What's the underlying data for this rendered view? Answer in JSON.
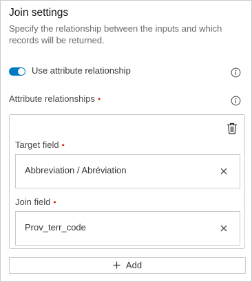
{
  "section": {
    "title": "Join settings",
    "description": "Specify the relationship between the inputs and which records will be returned."
  },
  "toggle": {
    "label": "Use attribute relationship",
    "checked": true,
    "color": "#007ac2"
  },
  "attribute_relationships": {
    "label": "Attribute relationships",
    "required_marker": "•",
    "target_field": {
      "label": "Target field",
      "required_marker": "•",
      "value": "Abbreviation / Abréviation"
    },
    "join_field": {
      "label": "Join field",
      "required_marker": "•",
      "value": "Prov_terr_code"
    }
  },
  "add_button": {
    "label": "Add"
  },
  "colors": {
    "accent": "#007ac2",
    "required": "#d83020",
    "border": "#cacaca"
  },
  "icons": [
    "info-icon",
    "trash-icon",
    "clear-icon",
    "plus-icon"
  ]
}
